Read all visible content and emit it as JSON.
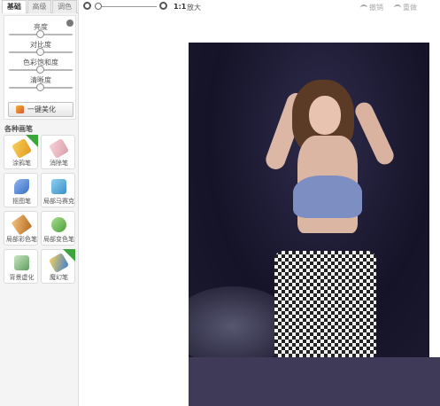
{
  "tabs": [
    "基础",
    "高级",
    "调色"
  ],
  "adjust": {
    "sliders": [
      {
        "label": "亮度",
        "level": 0.5
      },
      {
        "label": "对比度",
        "level": 0.5
      },
      {
        "label": "色彩饱和度",
        "level": 0.5
      },
      {
        "label": "清晰度",
        "level": 0.5
      }
    ],
    "beautify_label": "一键美化"
  },
  "brushes": {
    "title": "各种画笔",
    "items": [
      {
        "label": "涂鸦笔",
        "icon": "pencil-icon",
        "color": "#f0b92e",
        "ribbon": true
      },
      {
        "label": "消除笔",
        "icon": "eraser-icon",
        "color": "#e9a9b3",
        "ribbon": false
      },
      {
        "label": "抠图笔",
        "icon": "cutout-pen-icon",
        "color": "#4a7fd4",
        "ribbon": false
      },
      {
        "label": "局部马赛克",
        "icon": "mosaic-icon",
        "color": "#4aa3d8",
        "ribbon": false
      },
      {
        "label": "局部彩色笔",
        "icon": "paint-brush-icon",
        "color": "#d58b3a",
        "ribbon": false
      },
      {
        "label": "局部变色笔",
        "icon": "color-change-icon",
        "color": "#5eb14b",
        "ribbon": false
      },
      {
        "label": "背景虚化",
        "icon": "blur-icon",
        "color": "#67a86a",
        "ribbon": false
      },
      {
        "label": "魔幻笔",
        "icon": "magic-pen-icon",
        "color": "#3f7fd0",
        "ribbon": true
      }
    ]
  },
  "toolbar": {
    "actual_size": "1:1",
    "actual_size_sub": "",
    "enlarge": "放大",
    "undo": "撤销",
    "redo": "重做"
  }
}
